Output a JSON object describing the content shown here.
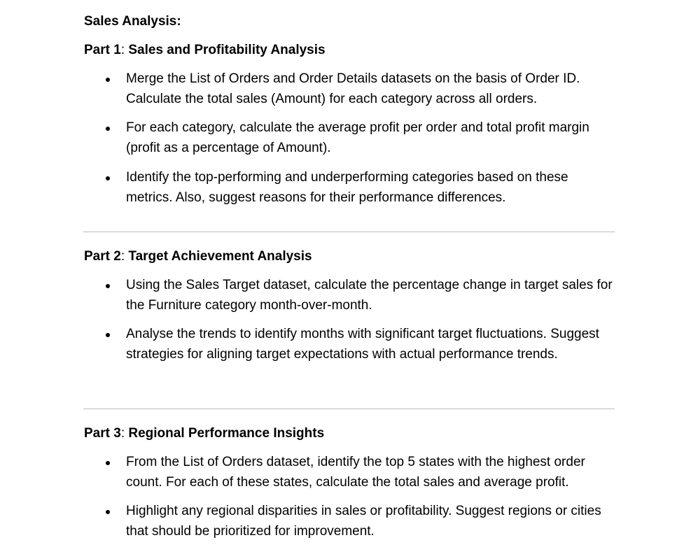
{
  "document": {
    "title": "Sales Analysis:",
    "parts": [
      {
        "number": "Part 1",
        "colon": ":",
        "title": "Sales and Profitability Analysis",
        "bullets": [
          "Merge the List of Orders and Order Details datasets on the basis of Order ID. Calculate the total sales (Amount) for each category across all orders.",
          "For each category, calculate the average profit per order and total profit margin (profit as a percentage of Amount).",
          "Identify the top-performing and underperforming categories based on these metrics. Also, suggest reasons for their performance differences."
        ]
      },
      {
        "number": "Part 2",
        "colon": ":",
        "title": "Target Achievement Analysis",
        "bullets": [
          "Using the Sales Target dataset, calculate the percentage change in target sales for the Furniture category month-over-month.",
          "Analyse the trends to identify months with significant target fluctuations. Suggest strategies for aligning target expectations with actual performance trends."
        ]
      },
      {
        "number": "Part 3",
        "colon": ":",
        "title": "Regional Performance Insights",
        "bullets": [
          "From the List of Orders dataset, identify the top 5 states with the highest order count. For each of these states, calculate the total sales and average profit.",
          "Highlight any regional disparities in sales or profitability. Suggest regions or cities that should be prioritized for improvement."
        ]
      }
    ]
  }
}
